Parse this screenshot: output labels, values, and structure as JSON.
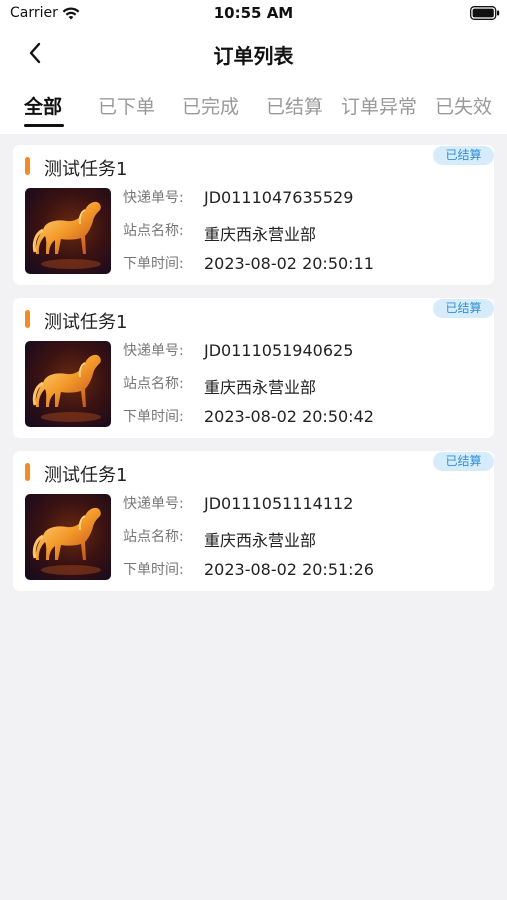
{
  "status_bar": {
    "carrier": "Carrier",
    "time": "10:55 AM"
  },
  "nav": {
    "title": "订单列表"
  },
  "tabs": [
    {
      "label": "全部",
      "active": true
    },
    {
      "label": "已下单",
      "active": false
    },
    {
      "label": "已完成",
      "active": false
    },
    {
      "label": "已结算",
      "active": false
    },
    {
      "label": "订单异常",
      "active": false
    },
    {
      "label": "已失效",
      "active": false
    }
  ],
  "labels": {
    "tracking": "快递单号:",
    "station": "站点名称:",
    "order_time": "下单时间:"
  },
  "orders": [
    {
      "title": "测试任务1",
      "status": "已结算",
      "tracking_no": "JD0111047635529",
      "station": "重庆西永营业部",
      "order_time": "2023-08-02 20:50:11"
    },
    {
      "title": "测试任务1",
      "status": "已结算",
      "tracking_no": "JD0111051940625",
      "station": "重庆西永营业部",
      "order_time": "2023-08-02 20:50:42"
    },
    {
      "title": "测试任务1",
      "status": "已结算",
      "tracking_no": "JD0111051114112",
      "station": "重庆西永营业部",
      "order_time": "2023-08-02 20:51:26"
    }
  ],
  "colors": {
    "accent_bar": "#f28c22",
    "status_tag_bg": "#d7ecfb",
    "status_tag_text": "#2f8fd6",
    "page_bg": "#f2f2f5"
  },
  "icons": {
    "back": "chevron-left-icon",
    "wifi": "wifi-icon",
    "battery": "battery-icon",
    "thumbnail": "glowing-horse-image"
  }
}
